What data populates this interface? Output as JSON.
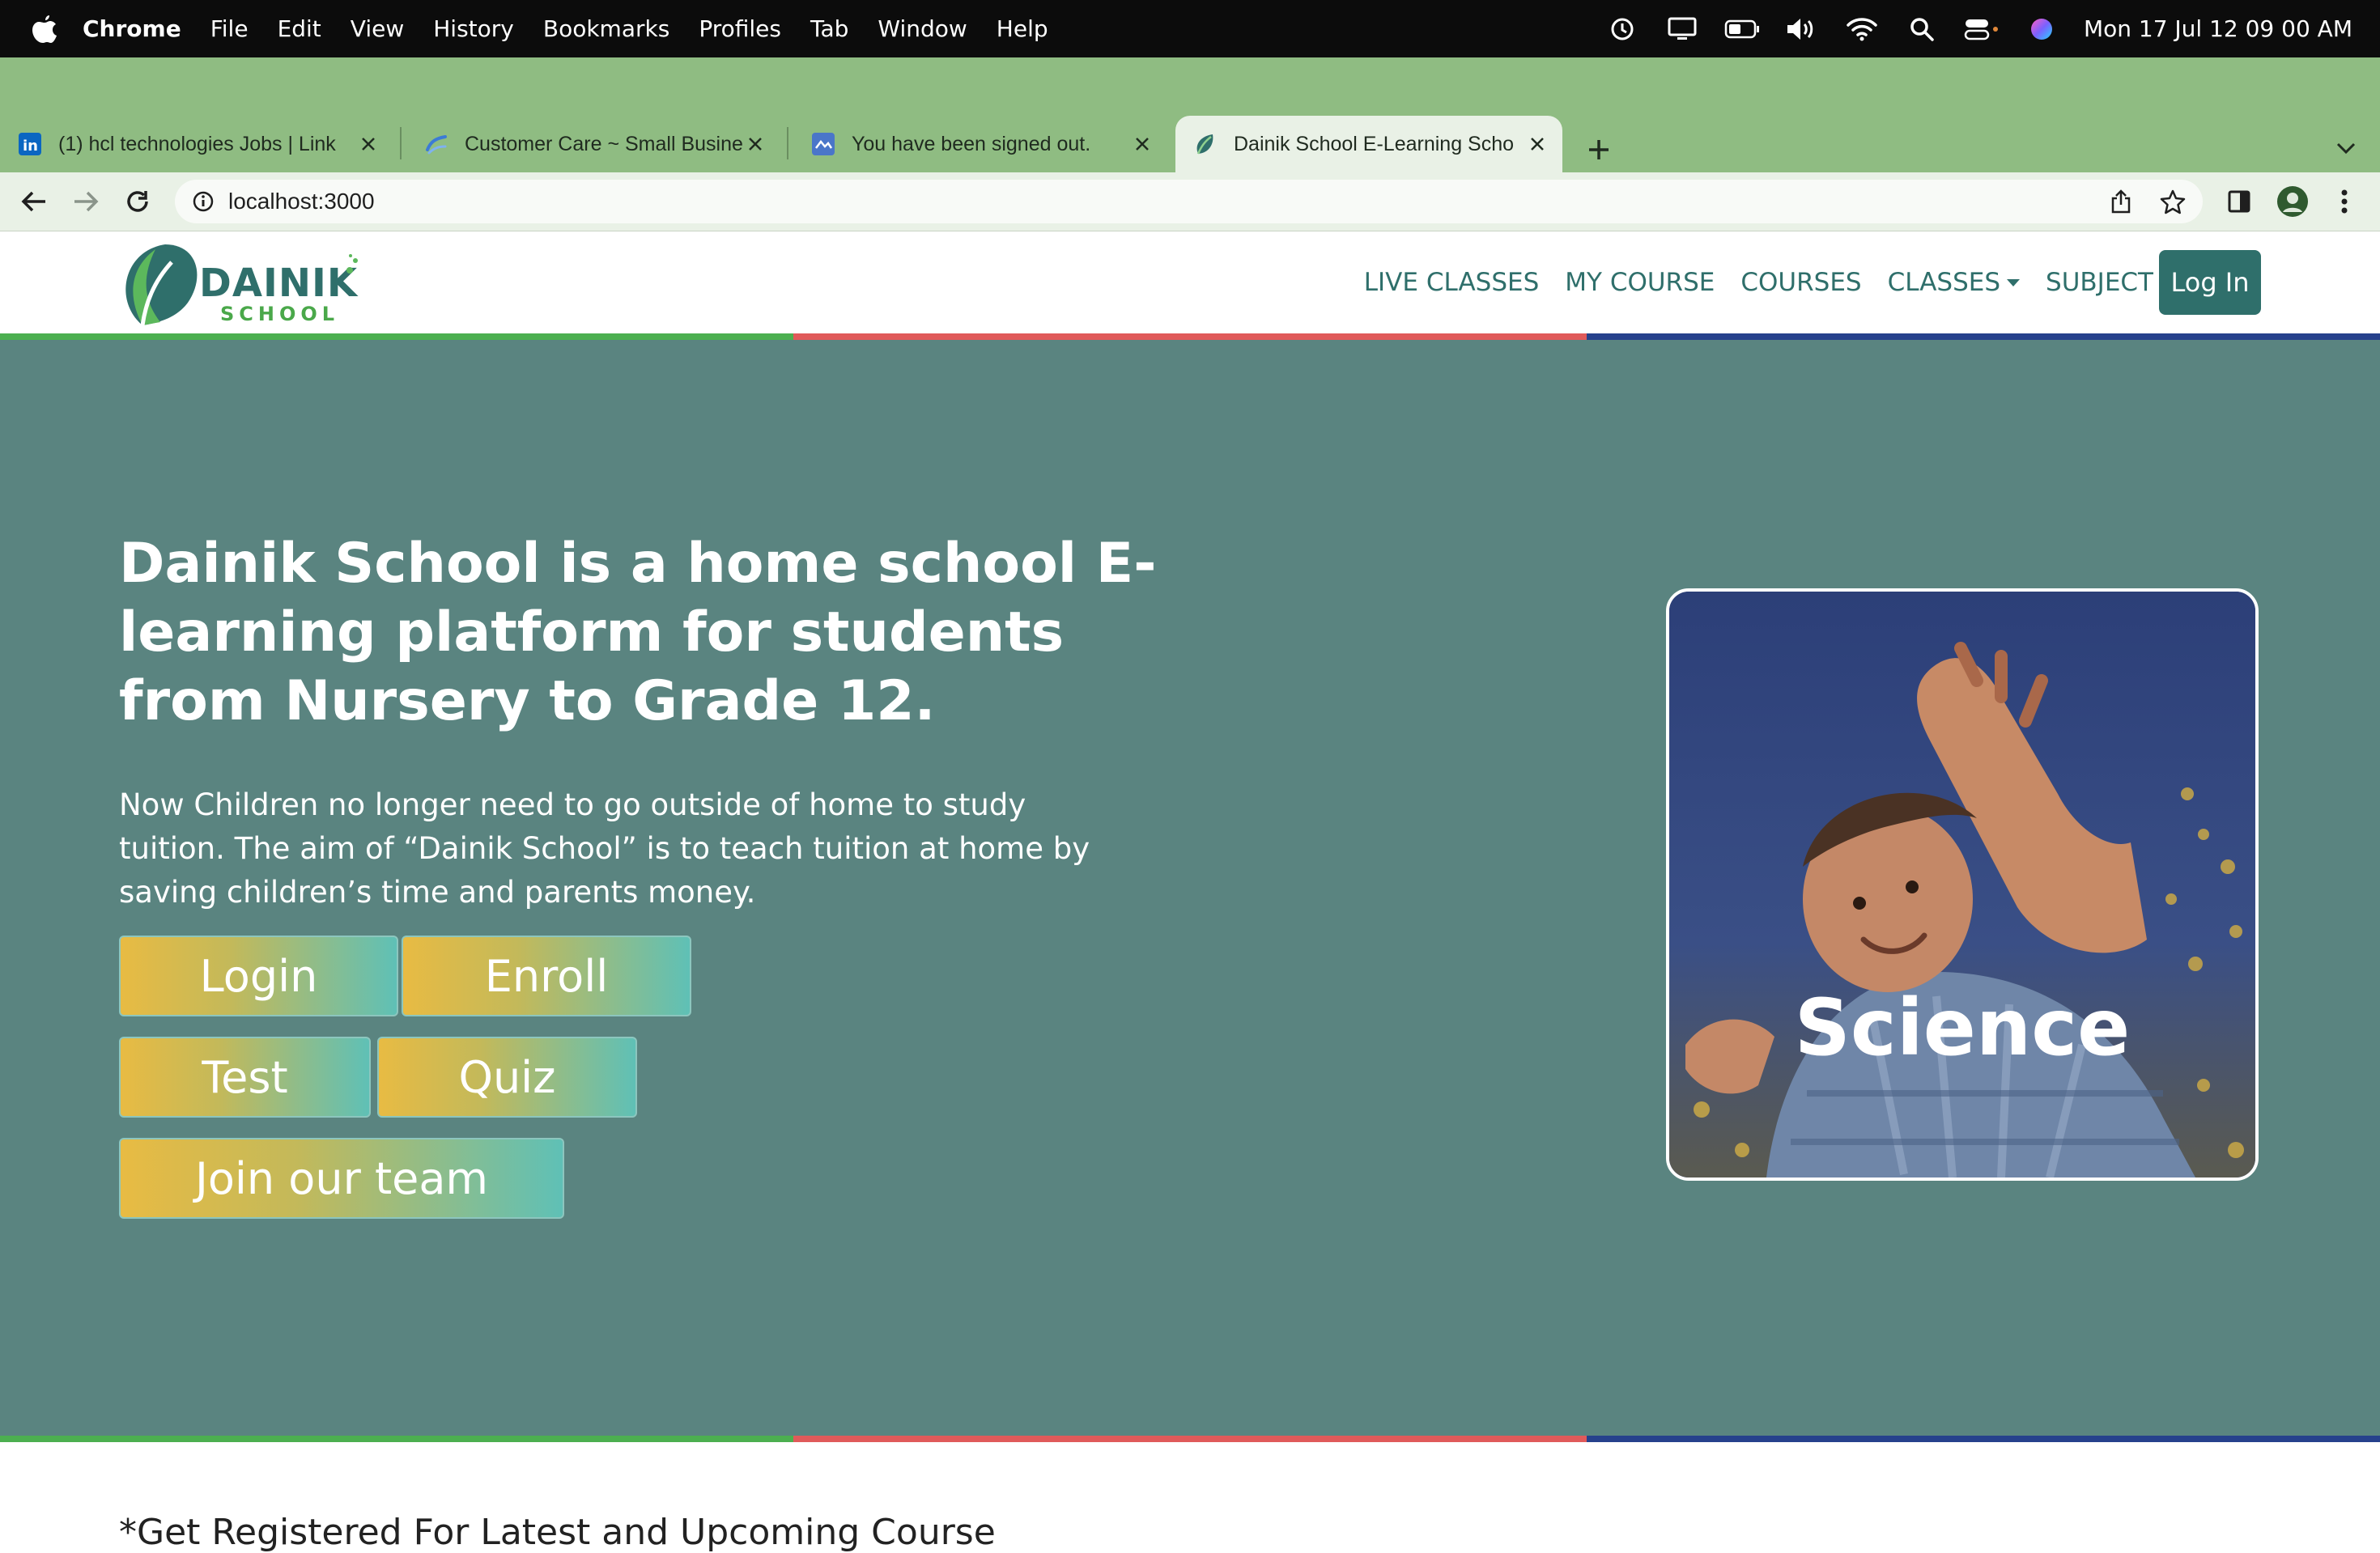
{
  "menubar": {
    "app": "Chrome",
    "items": [
      "File",
      "Edit",
      "View",
      "History",
      "Bookmarks",
      "Profiles",
      "Tab",
      "Window",
      "Help"
    ],
    "clock": "Mon 17 Jul  12 09 00 AM"
  },
  "tabs": [
    {
      "title": "(1) hcl technologies Jobs | Link",
      "icon": "linkedin-icon"
    },
    {
      "title": "Customer Care ~ Small Busine",
      "icon": "link-icon"
    },
    {
      "title": "You have been signed out.",
      "icon": "signed-out-icon"
    },
    {
      "title": "Dainik School E-Learning Scho",
      "icon": "dainik-leaf-icon",
      "active": true
    }
  ],
  "address_bar": {
    "url": "localhost:3000"
  },
  "site": {
    "logo": {
      "name": "DAINIK",
      "sub": "SCHOOL"
    },
    "nav": {
      "live_classes": "LIVE CLASSES",
      "my_course": "MY COURSE",
      "courses": "COURSES",
      "classes": "CLASSES",
      "subject": "SUBJECT",
      "login": "Log In"
    },
    "hero": {
      "title": "Dainik School is a home school E-learning platform for students from Nursery to Grade 12.",
      "text": "Now Children no longer need to go outside of home to study tuition. The aim of “Dainik School” is to teach tuition at home by saving children’s time and parents money.",
      "buttons": {
        "login": "Login",
        "enroll": "Enroll",
        "test": "Test",
        "quiz": "Quiz",
        "join": "Join our team"
      },
      "card_label": "Science"
    },
    "section_title": "*Get Registered For Latest and Upcoming Course"
  },
  "colors": {
    "hero_bg": "#5a8480",
    "brand": "#2f6f6b",
    "tab_strip": "#8fbc82",
    "stripe_green": "#4caf50",
    "stripe_red": "#e05a5a",
    "stripe_blue": "#26418c"
  }
}
